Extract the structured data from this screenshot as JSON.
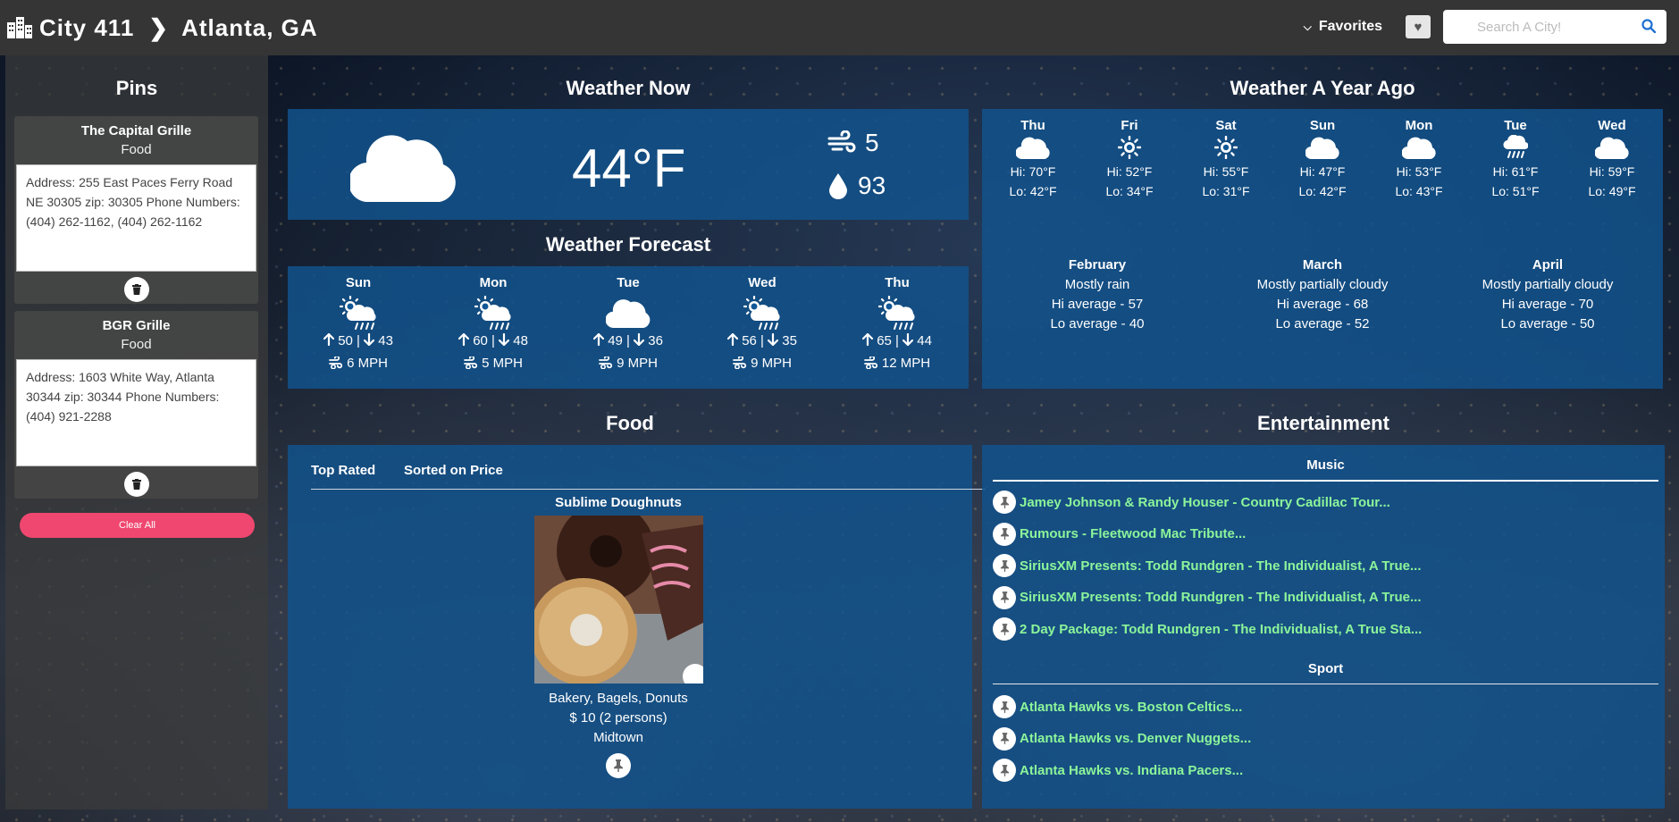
{
  "header": {
    "app_name": "City 411",
    "city": "Atlanta, GA",
    "favorites_label": "Favorites",
    "search_placeholder": "Search A City!"
  },
  "pins": {
    "title": "Pins",
    "items": [
      {
        "name": "The Capital Grille",
        "category": "Food",
        "details": "Address: 255 East Paces Ferry Road NE 30305 zip: 30305 Phone Numbers: (404) 262-1162, (404) 262-1162"
      },
      {
        "name": "BGR Grille",
        "category": "Food",
        "details": "Address: 1603 White Way, Atlanta 30344 zip: 30344 Phone Numbers: (404) 921-2288"
      }
    ],
    "clear_all_label": "Clear All"
  },
  "weather_now": {
    "title": "Weather Now",
    "icon": "cloud-icon",
    "temperature": "44°F",
    "wind": "5",
    "humidity": "93"
  },
  "forecast": {
    "title": "Weather Forecast",
    "days": [
      {
        "day": "Sun",
        "icon": "sun-rain-icon",
        "hi": "50",
        "lo": "43",
        "wind": "6 MPH"
      },
      {
        "day": "Mon",
        "icon": "sun-rain-icon",
        "hi": "60",
        "lo": "48",
        "wind": "5 MPH"
      },
      {
        "day": "Tue",
        "icon": "cloud-icon",
        "hi": "49",
        "lo": "36",
        "wind": "9 MPH"
      },
      {
        "day": "Wed",
        "icon": "sun-rain-icon",
        "hi": "56",
        "lo": "35",
        "wind": "9 MPH"
      },
      {
        "day": "Thu",
        "icon": "sun-rain-icon",
        "hi": "65",
        "lo": "44",
        "wind": "12 MPH"
      }
    ]
  },
  "year_ago": {
    "title": "Weather A Year Ago",
    "days": [
      {
        "day": "Thu",
        "icon": "cloud-icon",
        "hi": "Hi: 70°F",
        "lo": "Lo: 42°F"
      },
      {
        "day": "Fri",
        "icon": "sun-icon",
        "hi": "Hi: 52°F",
        "lo": "Lo: 34°F"
      },
      {
        "day": "Sat",
        "icon": "sun-icon",
        "hi": "Hi: 55°F",
        "lo": "Lo: 31°F"
      },
      {
        "day": "Sun",
        "icon": "cloud-icon",
        "hi": "Hi: 47°F",
        "lo": "Lo: 42°F"
      },
      {
        "day": "Mon",
        "icon": "cloud-icon",
        "hi": "Hi: 53°F",
        "lo": "Lo: 43°F"
      },
      {
        "day": "Tue",
        "icon": "cloud-rain-icon",
        "hi": "Hi: 61°F",
        "lo": "Lo: 51°F"
      },
      {
        "day": "Wed",
        "icon": "cloud-icon",
        "hi": "Hi: 59°F",
        "lo": "Lo: 49°F"
      }
    ],
    "months": [
      {
        "month": "February",
        "summary": "Mostly rain",
        "hi": "Hi average - 57",
        "lo": "Lo average - 40"
      },
      {
        "month": "March",
        "summary": "Mostly partially cloudy",
        "hi": "Hi average - 68",
        "lo": "Lo average - 52"
      },
      {
        "month": "April",
        "summary": "Mostly partially cloudy",
        "hi": "Hi average - 70",
        "lo": "Lo average - 50"
      }
    ]
  },
  "food": {
    "title": "Food",
    "tabs": [
      "Top Rated",
      "Sorted on Price"
    ],
    "restaurant": {
      "name": "Sublime Doughnuts",
      "categories": "Bakery, Bagels, Donuts",
      "price": "$ 10 (2 persons)",
      "area": "Midtown"
    }
  },
  "entertainment": {
    "title": "Entertainment",
    "music_label": "Music",
    "music": [
      "Jamey Johnson & Randy Houser - Country Cadillac Tour...",
      "Rumours - Fleetwood Mac Tribute...",
      "SiriusXM Presents: Todd Rundgren - The Individualist, A True...",
      "SiriusXM Presents: Todd Rundgren - The Individualist, A True...",
      "2 Day Package: Todd Rundgren - The Individualist, A True Sta..."
    ],
    "sport_label": "Sport",
    "sport": [
      "Atlanta Hawks vs. Boston Celtics...",
      "Atlanta Hawks vs. Denver Nuggets...",
      "Atlanta Hawks vs. Indiana Pacers..."
    ],
    "link_color": "#8cf59a"
  }
}
